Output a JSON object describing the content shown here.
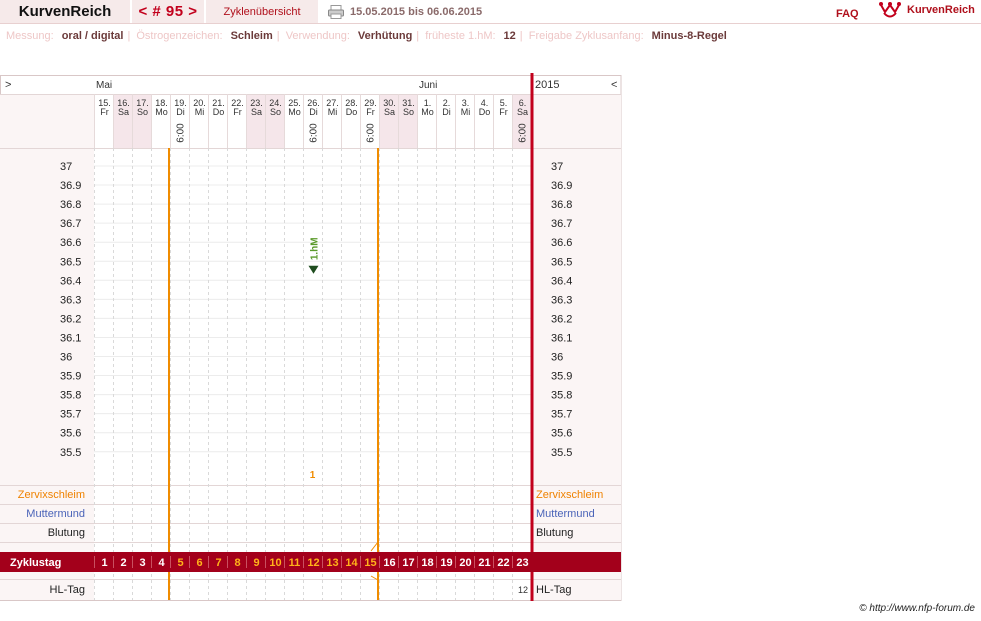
{
  "header": {
    "brand": "KurvenReich",
    "cycle_nav": "< # 95 >",
    "overview_tab": "Zyklenübersicht",
    "date_range": "15.05.2015 bis 06.06.2015",
    "faq": "FAQ",
    "logo_text": "KurvenReich",
    "icons": [
      "printer-icon",
      "kurvenreich-logo-icon"
    ]
  },
  "info": [
    {
      "label": "Messung:",
      "value": "oral / digital"
    },
    {
      "label": "Östrogenzeichen:",
      "value": "Schleim"
    },
    {
      "label": "Verwendung:",
      "value": "Verhütung"
    },
    {
      "label": "früheste 1.hM:",
      "value": "12"
    },
    {
      "label": "Freigabe Zyklusanfang:",
      "value": "Minus-8-Regel"
    }
  ],
  "chart": {
    "nav_prev": ">",
    "nav_next": "<",
    "year": "2015",
    "months": [
      {
        "label": "Mai",
        "start_index": 0
      },
      {
        "label": "Juni",
        "start_index": 17
      }
    ],
    "days": [
      {
        "date": "15.",
        "wd": "Fr"
      },
      {
        "date": "16.",
        "wd": "Sa"
      },
      {
        "date": "17.",
        "wd": "So"
      },
      {
        "date": "18.",
        "wd": "Mo"
      },
      {
        "date": "19.",
        "wd": "Di",
        "time": "6:00"
      },
      {
        "date": "20.",
        "wd": "Mi"
      },
      {
        "date": "21.",
        "wd": "Do"
      },
      {
        "date": "22.",
        "wd": "Fr"
      },
      {
        "date": "23.",
        "wd": "Sa"
      },
      {
        "date": "24.",
        "wd": "So"
      },
      {
        "date": "25.",
        "wd": "Mo"
      },
      {
        "date": "26.",
        "wd": "Di",
        "time": "6:00"
      },
      {
        "date": "27.",
        "wd": "Mi"
      },
      {
        "date": "28.",
        "wd": "Do"
      },
      {
        "date": "29.",
        "wd": "Fr",
        "time": "6:00"
      },
      {
        "date": "30.",
        "wd": "Sa"
      },
      {
        "date": "31.",
        "wd": "So"
      },
      {
        "date": "1.",
        "wd": "Mo"
      },
      {
        "date": "2.",
        "wd": "Di"
      },
      {
        "date": "3.",
        "wd": "Mi"
      },
      {
        "date": "4.",
        "wd": "Do"
      },
      {
        "date": "5.",
        "wd": "Fr"
      },
      {
        "date": "6.",
        "wd": "Sa",
        "time": "6:00"
      }
    ],
    "weekend_days": [
      1,
      2,
      8,
      9,
      15,
      16,
      22
    ],
    "temperature_ticks": [
      "37",
      "36.9",
      "36.8",
      "36.7",
      "36.6",
      "36.5",
      "36.4",
      "36.3",
      "36.2",
      "36.1",
      "36",
      "35.9",
      "35.8",
      "35.7",
      "35.6",
      "35.5"
    ],
    "marker": {
      "day_index": 11,
      "temp": 36.45,
      "label": "1.hM",
      "count_label": "1"
    },
    "orange_lines_after_day": [
      3,
      14
    ],
    "rows": {
      "zervix": "Zervixschleim",
      "muttermund": "Muttermund",
      "blutung": "Blutung",
      "zyklustag": "Zyklustag",
      "hltag": "HL-Tag"
    },
    "cycle_days": [
      "1",
      "2",
      "3",
      "4",
      "5",
      "6",
      "7",
      "8",
      "9",
      "10",
      "11",
      "12",
      "13",
      "14",
      "15",
      "16",
      "17",
      "18",
      "19",
      "20",
      "21",
      "22",
      "23"
    ],
    "highlight_cycle_days_from": 5,
    "highlight_cycle_days_to": 15,
    "hl_tag_value": "12",
    "colors": {
      "accent": "#c2001c",
      "zyklus_bar": "#a3001b",
      "orange": "#f08c00",
      "weekend": "#f5e6ea",
      "zervix_text": "#ef8200",
      "muttermund_text": "#4a63b8",
      "marker_green": "#5a9a2a",
      "marker_dark": "#1f4d1f"
    }
  },
  "footer": {
    "copyright": "© http://www.nfp-forum.de"
  }
}
